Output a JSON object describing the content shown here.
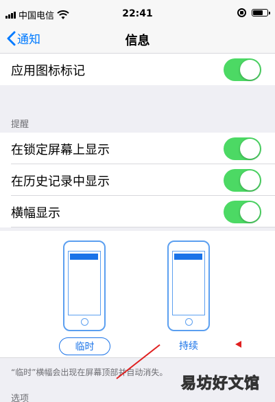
{
  "status_bar": {
    "carrier": "中国电信",
    "time": "22:41"
  },
  "nav": {
    "back_label": "通知",
    "title": "信息"
  },
  "settings": {
    "badge_label": "应用图标标记",
    "alerts_header": "提醒",
    "lock_screen_label": "在锁定屏幕上显示",
    "history_label": "在历史记录中显示",
    "banners_label": "横幅显示",
    "toggles": {
      "badge": true,
      "lock_screen": true,
      "history": true,
      "banners": true
    }
  },
  "banner_style": {
    "temporary_label": "临时",
    "persistent_label": "持续",
    "selected": "临时"
  },
  "footnote": "“临时”横幅会出现在屏幕顶部并自动消失。",
  "options_header": "选项",
  "watermark": "易坊好文馆",
  "colors": {
    "accent": "#007aff",
    "toggle_on": "#4cd964",
    "background": "#efeff4"
  }
}
